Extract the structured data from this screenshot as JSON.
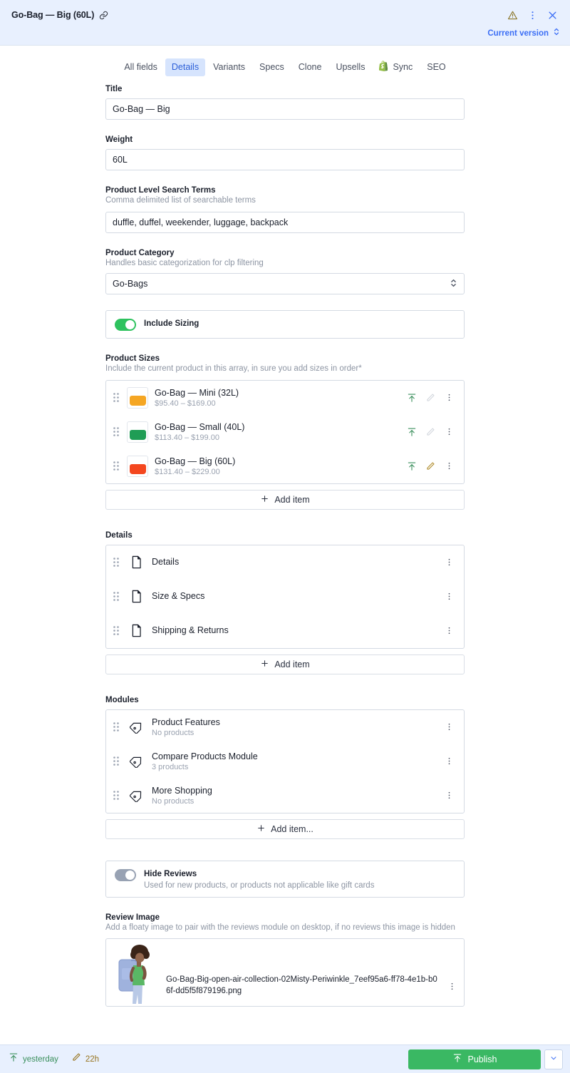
{
  "header": {
    "doc_title": "Go-Bag — Big (60L)",
    "link_icon": "link-icon",
    "warning_icon": "warning-triangle-icon",
    "kebab_icon": "kebab-menu-icon",
    "close_icon": "close-icon",
    "version_label": "Current version",
    "version_caret_icon": "chevron-updown-icon",
    "accent_blue": "#3b6ef5",
    "warning_color": "#8a7526",
    "bg": "#e8f0fe"
  },
  "tabs": [
    {
      "label": "All fields",
      "active": false,
      "icon": null
    },
    {
      "label": "Details",
      "active": true,
      "icon": null
    },
    {
      "label": "Variants",
      "active": false,
      "icon": null
    },
    {
      "label": "Specs",
      "active": false,
      "icon": null
    },
    {
      "label": "Clone",
      "active": false,
      "icon": null
    },
    {
      "label": "Upsells",
      "active": false,
      "icon": null
    },
    {
      "label": "Sync",
      "active": false,
      "icon": "shopify-icon"
    },
    {
      "label": "SEO",
      "active": false,
      "icon": null
    }
  ],
  "fields": {
    "title": {
      "label": "Title",
      "value": "Go-Bag — Big"
    },
    "weight": {
      "label": "Weight",
      "value": "60L"
    },
    "search_terms": {
      "label": "Product Level Search Terms",
      "description": "Comma delimited list of searchable terms",
      "value": "duffle, duffel, weekender, luggage, backpack"
    },
    "category": {
      "label": "Product Category",
      "description": "Handles basic categorization for clp filtering",
      "value": "Go-Bags"
    },
    "include_sizing": {
      "label": "Include Sizing",
      "state": "on"
    },
    "product_sizes": {
      "label": "Product Sizes",
      "description": "Include the current product in this array, in sure you add sizes in order*",
      "add_label": "Add item",
      "items": [
        {
          "title": "Go-Bag — Mini (32L)",
          "subtitle": "$95.40 – $169.00",
          "thumb_color": "#f5a623",
          "thumb_color_dark": "#e8941a",
          "edit_active": false
        },
        {
          "title": "Go-Bag — Small (40L)",
          "subtitle": "$113.40 – $199.00",
          "thumb_color": "#1f9d55",
          "thumb_color_dark": "#178548",
          "edit_active": false
        },
        {
          "title": "Go-Bag — Big (60L)",
          "subtitle": "$131.40 – $229.00",
          "thumb_color": "#f4471f",
          "thumb_color_dark": "#e03a14",
          "edit_active": true
        }
      ]
    },
    "details": {
      "label": "Details",
      "add_label": "Add item",
      "items": [
        {
          "title": "Details",
          "icon": "document-icon"
        },
        {
          "title": "Size & Specs",
          "icon": "document-icon"
        },
        {
          "title": "Shipping & Returns",
          "icon": "document-icon"
        }
      ]
    },
    "modules": {
      "label": "Modules",
      "add_label": "Add item...",
      "items": [
        {
          "title": "Product Features",
          "subtitle": "No products",
          "icon": "tag-icon"
        },
        {
          "title": "Compare Products Module",
          "subtitle": "3 products",
          "icon": "tag-icon"
        },
        {
          "title": "More Shopping",
          "subtitle": "No products",
          "icon": "tag-icon"
        }
      ]
    },
    "hide_reviews": {
      "label": "Hide Reviews",
      "description": "Used for new products, or products not applicable like gift cards",
      "state": "off"
    },
    "review_image": {
      "label": "Review Image",
      "description": "Add a floaty image to pair with the reviews module on desktop, if no reviews this image is hidden",
      "filename": "Go-Bag-Big-open-air-collection-02Misty-Periwinkle_7eef95a6-ff78-4e1b-b06f-dd5f5f879196.png"
    }
  },
  "footer": {
    "publish_stat": {
      "icon": "publish-icon",
      "label": "yesterday",
      "color": "#3a8f5c"
    },
    "edit_stat": {
      "icon": "pencil-icon",
      "label": "22h",
      "color": "#97741f"
    },
    "publish_button": {
      "label": "Publish",
      "icon": "publish-icon",
      "color": "#3ab863"
    },
    "publish_caret_icon": "chevron-down-icon"
  },
  "colors": {
    "green": "#2ec25e",
    "gold": "#b08d2e",
    "blue": "#3b6ef5",
    "border": "#d4dae3",
    "muted": "#8d95a3"
  }
}
